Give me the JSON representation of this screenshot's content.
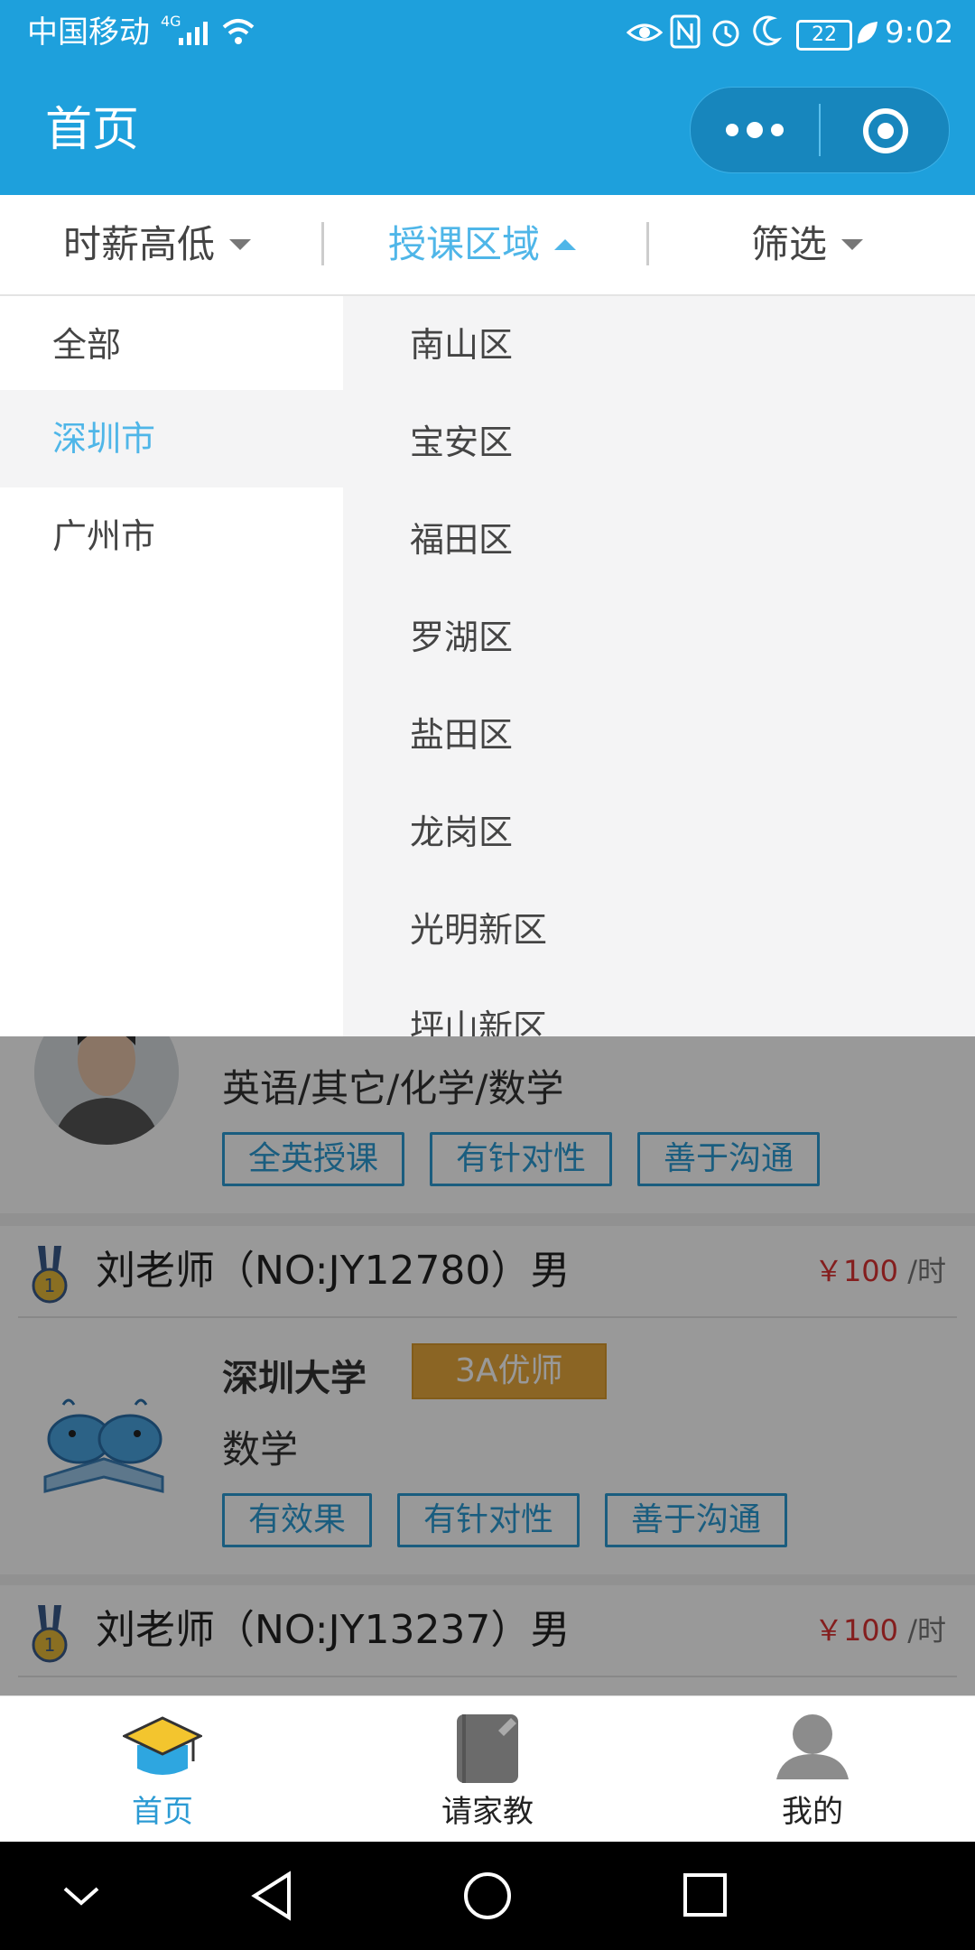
{
  "status": {
    "carrier": "中国移动",
    "network": "4G",
    "battery": "22",
    "time": "9:02"
  },
  "header": {
    "title": "首页"
  },
  "filters": [
    {
      "label": "时薪高低",
      "state": "collapsed"
    },
    {
      "label": "授课区域",
      "state": "expanded"
    },
    {
      "label": "筛选",
      "state": "collapsed"
    }
  ],
  "dropdown": {
    "cities": [
      "全部",
      "深圳市",
      "广州市"
    ],
    "selected_city": "深圳市",
    "districts": [
      "南山区",
      "宝安区",
      "福田区",
      "罗湖区",
      "盐田区",
      "龙岗区",
      "光明新区",
      "坪山新区"
    ]
  },
  "teachers": [
    {
      "subjects": "英语/其它/化学/数学",
      "tags": [
        "全英授课",
        "有针对性",
        "善于沟通"
      ]
    },
    {
      "name": "刘老师（NO:JY12780）男",
      "price": "￥100",
      "unit": " /时",
      "school": "深圳大学",
      "badge": "3A优师",
      "subjects": "数学",
      "tags": [
        "有效果",
        "有针对性",
        "善于沟通"
      ]
    },
    {
      "name": "刘老师（NO:JY13237）男",
      "price": "￥100",
      "unit": " /时"
    }
  ],
  "tabbar": {
    "items": [
      {
        "label": "首页",
        "active": true
      },
      {
        "label": "请家教"
      },
      {
        "label": "我的"
      }
    ]
  },
  "colors": {
    "primary": "#1ea0dc",
    "accent": "#4fb6e8",
    "price": "#dd3333",
    "badge": "#e8a93d"
  }
}
